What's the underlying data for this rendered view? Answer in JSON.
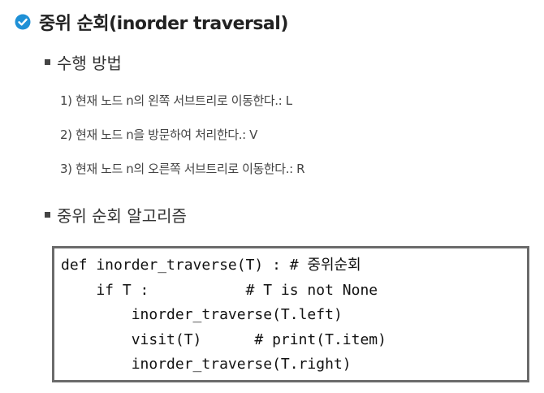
{
  "title": "중위 순회(inorder traversal)",
  "section1": {
    "title": "수행 방법",
    "steps": [
      "1) 현재 노드 n의 왼쪽 서브트리로 이동한다.: L",
      "2) 현재 노드 n을 방문하여 처리한다.: V",
      "3) 현재 노드 n의 오른쪽 서브트리로 이동한다.: R"
    ]
  },
  "section2": {
    "title": "중위 순회 알고리즘"
  },
  "code": {
    "lines": [
      "def inorder_traverse(T) : # 중위순회",
      "    if T :           # T is not None",
      "        inorder_traverse(T.left)",
      "        visit(T)      # print(T.item)",
      "        inorder_traverse(T.right)"
    ]
  },
  "colors": {
    "check_icon": "#1e90d6",
    "code_border": "#6b6b6b",
    "bullet": "#444444"
  }
}
